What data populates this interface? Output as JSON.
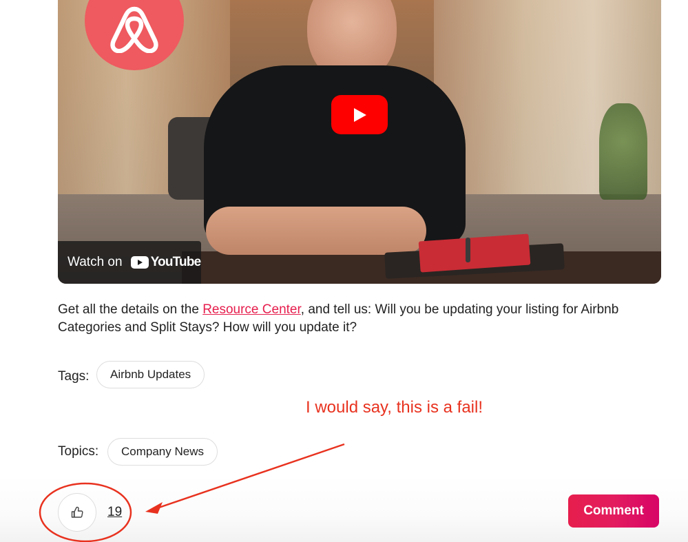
{
  "video": {
    "watch_on_label": "Watch on",
    "youtube_wordmark": "YouTube",
    "play_icon": "play-icon",
    "logo_icon": "airbnb-logo-icon"
  },
  "post": {
    "text_before_link": "Get all the details on the ",
    "link_text": "Resource Center",
    "text_after_link": ", and tell us: Will you be updating your listing for Airbnb Categories and Split Stays? How will you update it?"
  },
  "tags": {
    "label": "Tags:",
    "items": [
      "Airbnb Updates"
    ]
  },
  "topics": {
    "label": "Topics:",
    "items": [
      "Company News"
    ]
  },
  "annotation": {
    "text": "I would say, this is a fail!",
    "color": "#e8321f"
  },
  "actions": {
    "like_icon": "thumbs-up-icon",
    "like_count": "19",
    "comment_label": "Comment"
  },
  "colors": {
    "brand": "#e61e4d",
    "youtube_red": "#ff0000",
    "logo_badge": "#ee5a5f"
  }
}
